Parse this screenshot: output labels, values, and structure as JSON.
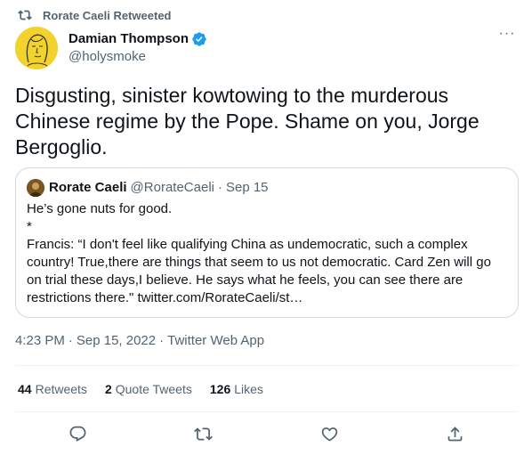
{
  "retweet": {
    "text": "Rorate Caeli Retweeted",
    "icon": "retweet-icon"
  },
  "author": {
    "name": "Damian Thompson",
    "handle": "@holysmoke",
    "verified": true,
    "avatar_bg": "#f2d22c"
  },
  "more_label": "···",
  "tweet": {
    "text": "Disgusting, sinister kowtowing to the murderous Chinese regime by the Pope. Shame on you, Jorge Bergoglio."
  },
  "quote": {
    "name": "Rorate Caeli",
    "handle": "@RorateCaeli",
    "dot": "·",
    "date": "Sep 15",
    "body": "He’s gone nuts for good.\n*\nFrancis: “I don't feel like qualifying China as undemocratic, such a complex country! True,there are things that seem to us not democratic. Card Zen will go on trial these days,I believe. He says what he feels, you can see there are restrictions there.\" twitter.com/RorateCaeli/st…"
  },
  "meta": {
    "time": "4:23 PM",
    "sep": "·",
    "date": "Sep 15, 2022",
    "source": "Twitter Web App"
  },
  "stats": {
    "retweets_count": "44",
    "retweets_label": "Retweets",
    "quotes_count": "2",
    "quotes_label": "Quote Tweets",
    "likes_count": "126",
    "likes_label": "Likes"
  },
  "actions": [
    "reply-icon",
    "retweet-icon",
    "like-icon",
    "share-icon"
  ],
  "colors": {
    "text": "#0f1419",
    "secondary": "#536471",
    "verified": "#1d9bf0",
    "border": "#cfd9de"
  }
}
